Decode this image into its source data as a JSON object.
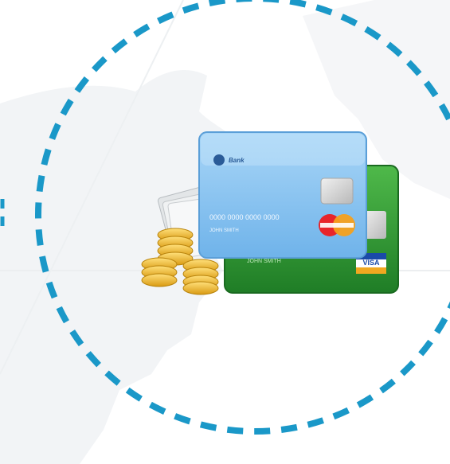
{
  "illustration": {
    "icon_name": "payment-cards-and-coins-icon",
    "front_card": {
      "bank_label": "Bank",
      "card_number": "0000 0000 0000 0000",
      "holder_name": "JOHN SMITH",
      "network_logo": "mastercard-logo"
    },
    "back_card": {
      "holder_name": "JOHN SMITH",
      "network_logo": "visa-logo"
    },
    "colors": {
      "ring": "#1a98c8",
      "front_card": "#8ec7f2",
      "back_card": "#2e9a33",
      "coins": "#e8b326",
      "background_map": "#f1f3f5"
    }
  }
}
